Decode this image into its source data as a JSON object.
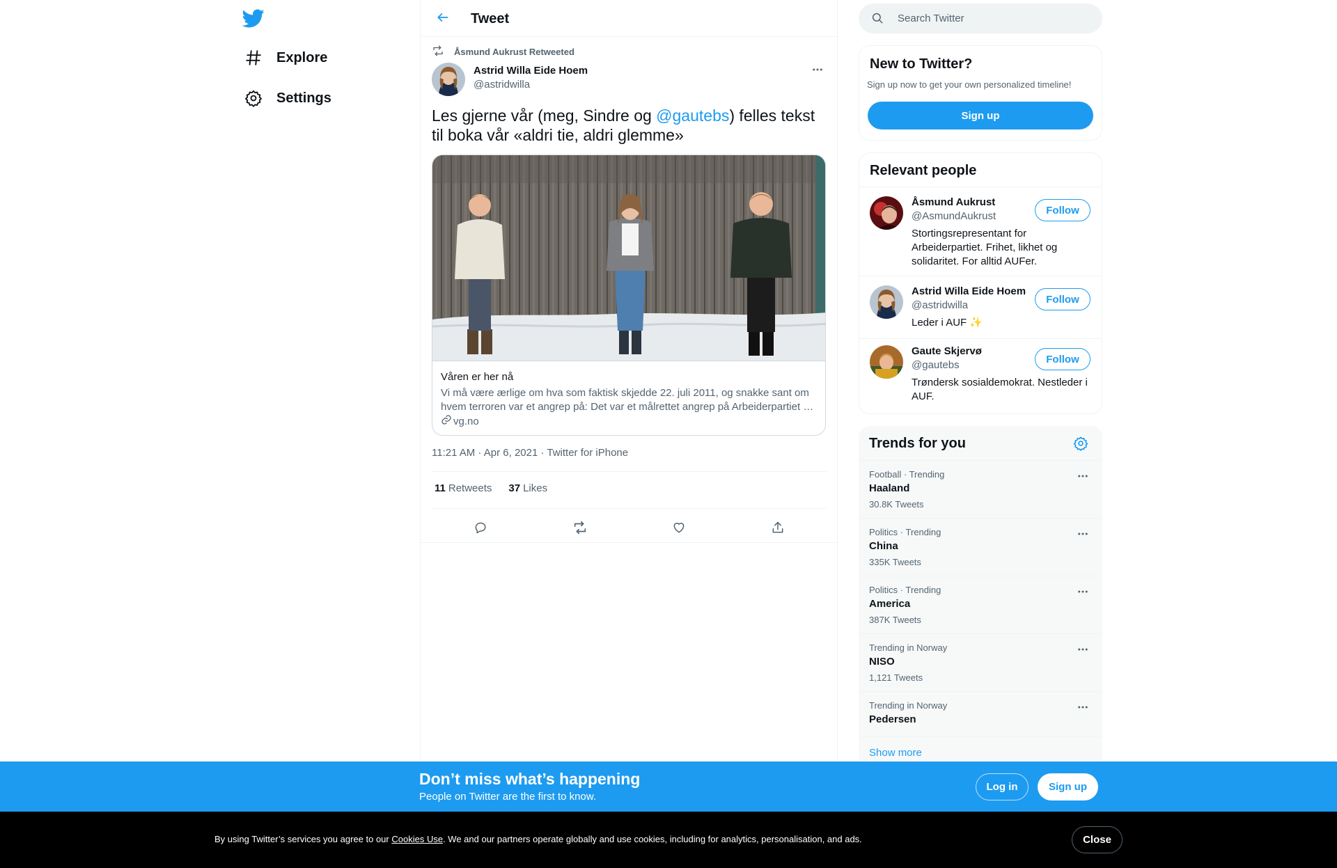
{
  "nav": {
    "logo_icon": "twitter-bird-icon",
    "items": [
      {
        "label": "Explore",
        "icon": "hashtag-icon"
      },
      {
        "label": "Settings",
        "icon": "gear-icon"
      }
    ]
  },
  "header": {
    "title": "Tweet",
    "back_icon": "arrow-left-icon"
  },
  "tweet": {
    "retweeted_by": "Åsmund Aukrust Retweeted",
    "author": {
      "name": "Astrid Willa Eide Hoem",
      "handle": "@astridwilla"
    },
    "text_before": "Les gjerne vår (meg, Sindre og ",
    "mention": "@gautebs",
    "text_after": ") felles tekst til boka vår «aldri tie, aldri glemme»",
    "card": {
      "title": "Våren er her nå",
      "description": "Vi må være ærlige om hva som faktisk skjedde 22. juli 2011, og snakke sant om hvem terroren var et angrep på: Det var et målrettet angrep på Arbeiderpartiet …",
      "domain": "vg.no"
    },
    "meta": "11:21 AM · Apr 6, 2021 · Twitter for iPhone",
    "retweets_count": "11",
    "retweets_label": "Retweets",
    "likes_count": "37",
    "likes_label": "Likes"
  },
  "search": {
    "placeholder": "Search Twitter"
  },
  "signup_box": {
    "title": "New to Twitter?",
    "subtitle": "Sign up now to get your own personalized timeline!",
    "button": "Sign up"
  },
  "relevant_people": {
    "title": "Relevant people",
    "people": [
      {
        "name": "Åsmund Aukrust",
        "handle": "@AsmundAukrust",
        "bio": "Stortingsrepresentant for Arbeiderpartiet. Frihet, likhet og solidaritet. For alltid AUFer.",
        "follow": "Follow"
      },
      {
        "name": "Astrid Willa Eide Hoem",
        "handle": "@astridwilla",
        "bio": "Leder i AUF ✨",
        "follow": "Follow"
      },
      {
        "name": "Gaute Skjervø",
        "handle": "@gautebs",
        "bio": "Trøndersk sosialdemokrat. Nestleder i AUF.",
        "follow": "Follow"
      }
    ]
  },
  "trends": {
    "title": "Trends for you",
    "items": [
      {
        "category": "Football · Trending",
        "name": "Haaland",
        "count": "30.8K Tweets"
      },
      {
        "category": "Politics · Trending",
        "name": "China",
        "count": "335K Tweets"
      },
      {
        "category": "Politics · Trending",
        "name": "America",
        "count": "387K Tweets"
      },
      {
        "category": "Trending in Norway",
        "name": "NISO",
        "count": "1,121 Tweets"
      },
      {
        "category": "Trending in Norway",
        "name": "Pedersen",
        "count": ""
      }
    ],
    "show_more": "Show more"
  },
  "banner": {
    "title": "Don’t miss what’s happening",
    "subtitle": "People on Twitter are the first to know.",
    "login": "Log in",
    "signup": "Sign up"
  },
  "cookie": {
    "text_before": "By using Twitter’s services you agree to our ",
    "link": "Cookies Use",
    "text_after": ". We and our partners operate globally and use cookies, including for analytics, personalisation, and ads.",
    "close": "Close"
  },
  "colors": {
    "accent": "#1d9bf0",
    "text": "#0f1419",
    "secondary": "#536471",
    "border": "#eff3f4"
  }
}
